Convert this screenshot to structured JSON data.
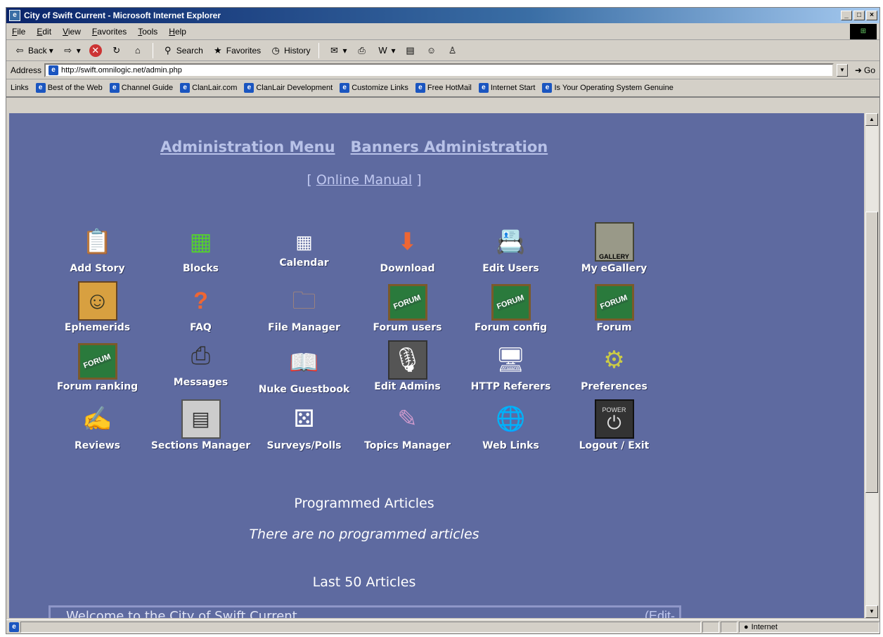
{
  "window": {
    "title": "City of Swift Current - Microsoft Internet Explorer"
  },
  "menubar": {
    "items": [
      "File",
      "Edit",
      "View",
      "Favorites",
      "Tools",
      "Help"
    ]
  },
  "toolbar": {
    "back": "Back",
    "search": "Search",
    "favorites": "Favorites",
    "history": "History"
  },
  "address": {
    "label": "Address",
    "url": "http://swift.omnilogic.net/admin.php",
    "go": "Go"
  },
  "links": {
    "label": "Links",
    "items": [
      "Best of the Web",
      "Channel Guide",
      "ClanLair.com",
      "ClanLair Development",
      "Customize Links",
      "Free HotMail",
      "Internet Start",
      "Is Your Operating System Genuine"
    ]
  },
  "page": {
    "nav": {
      "admin_menu": "Administration Menu",
      "banners": "Banners Administration"
    },
    "manual": {
      "open": "[",
      "link": "Online Manual",
      "close": "]"
    },
    "icons": [
      {
        "label": "Add Story",
        "icon": "clipboard-icon"
      },
      {
        "label": "Blocks",
        "icon": "blocks-icon"
      },
      {
        "label": "Calendar",
        "icon": "calendar-icon"
      },
      {
        "label": "Download",
        "icon": "download-icon"
      },
      {
        "label": "Edit Users",
        "icon": "address-book-icon"
      },
      {
        "label": "My eGallery",
        "icon": "gallery-icon"
      },
      {
        "label": "Ephemerids",
        "icon": "portrait-icon"
      },
      {
        "label": "FAQ",
        "icon": "question-icon"
      },
      {
        "label": "File Manager",
        "icon": "folder-icon"
      },
      {
        "label": "Forum users",
        "icon": "forum-icon"
      },
      {
        "label": "Forum config",
        "icon": "forum-icon"
      },
      {
        "label": "Forum",
        "icon": "forum-icon"
      },
      {
        "label": "Forum ranking",
        "icon": "forum-icon"
      },
      {
        "label": "Messages",
        "icon": "printer-icon"
      },
      {
        "label": "Nuke Guestbook",
        "icon": "guestbook-icon"
      },
      {
        "label": "Edit Admins",
        "icon": "microphone-icon"
      },
      {
        "label": "HTTP Referers",
        "icon": "computers-icon"
      },
      {
        "label": "Preferences",
        "icon": "gear-icon"
      },
      {
        "label": "Reviews",
        "icon": "pen-paper-icon"
      },
      {
        "label": "Sections Manager",
        "icon": "sections-icon"
      },
      {
        "label": "Surveys/Polls",
        "icon": "dice-icon"
      },
      {
        "label": "Topics Manager",
        "icon": "topics-icon"
      },
      {
        "label": "Web Links",
        "icon": "globe-icon"
      },
      {
        "label": "Logout / Exit",
        "icon": "power-icon"
      }
    ],
    "forum_badge": "FORUM",
    "gallery_badge": "GALLERY",
    "power_badge": "POWER",
    "programmed": {
      "title": "Programmed Articles",
      "note": "There are no programmed articles"
    },
    "last": {
      "title": "Last 50 Articles",
      "first_article": "Welcome to the City of Swift Current",
      "edit": "(Edit-"
    }
  },
  "status": {
    "zone": "Internet"
  }
}
